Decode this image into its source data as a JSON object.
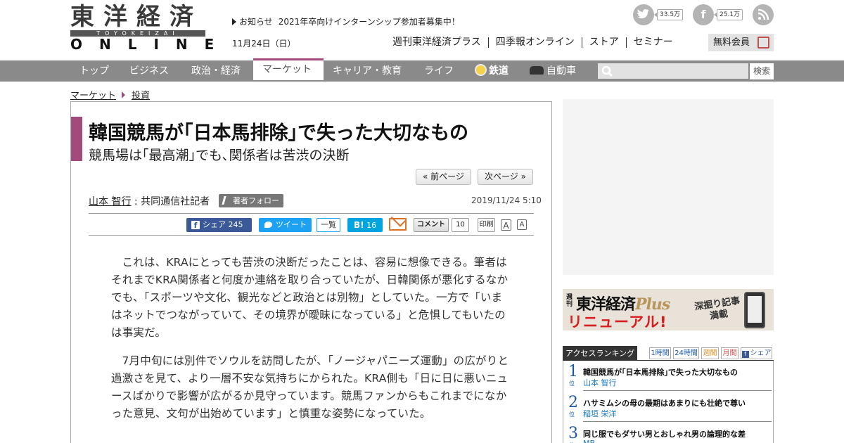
{
  "header": {
    "logo_kanji": "東洋経済",
    "logo_band": "TOYOKEIZAI",
    "logo_online": "ONLINE",
    "notice_label": "お知らせ",
    "notice_text": "2021年卒向けインターンシップ参加者募集中！",
    "date": "11月24日（日）",
    "social": {
      "twitter_count": "33.5万",
      "facebook_count": "25.1万"
    },
    "links": [
      "週刊東洋経済プラス",
      "四季報オンライン",
      "ストア",
      "セミナー"
    ],
    "member_button": "無料会員"
  },
  "nav": {
    "items": [
      "トップ",
      "ビジネス",
      "政治・経済",
      "マーケット",
      "キャリア・教育",
      "ライフ",
      "鉄道",
      "自動車"
    ],
    "active_index": 3,
    "search_placeholder": "",
    "search_button": "検索"
  },
  "breadcrumb": [
    "マーケット",
    "投資"
  ],
  "article": {
    "title": "韓国競馬が｢日本馬排除｣で失った大切なもの",
    "subtitle": "競馬場は｢最高潮｣でも､関係者は苦渋の決断",
    "prev_page": "« 前ページ",
    "next_page": "次ページ »",
    "author_name": "山本 智行",
    "author_affiliation": " : 共同通信社記者",
    "follow_label": "著者フォロー",
    "timestamp": "2019/11/24 5:10",
    "share": {
      "facebook_label": "シェア",
      "facebook_count": "245",
      "tweet_label": "ツイート",
      "list_label": "一覧",
      "hatena_label": "B!",
      "hatena_count": "16",
      "comment_label": "コメント",
      "comment_count": "10",
      "print_label": "印刷",
      "font_large": "A",
      "font_small": "A"
    },
    "paragraphs": [
      "これは、KRAにとっても苦渋の決断だったことは、容易に想像できる。筆者はそれまでKRA関係者と何度か連絡を取り合っていたが、日韓関係が悪化するなかでも、「スポーツや文化、観光などと政治とは別物」としていた。一方で「いまはネットでつながっていて、その境界が曖昧になっている」と危惧してもいたのは事実だ。",
      "7月中旬には別件でソウルを訪問したが、「ノージャパニーズ運動」の広がりと過激さを見て、より一層不安な気持ちにかられた。KRA側も「日に日に悪いニュースばかりで影響が広がるか見守っています。競馬ファンからもこれまでになかった意見、文句が出始めています」と慎重な姿勢になっていた。"
    ]
  },
  "sidebar": {
    "banner": {
      "weekly": "週刊",
      "name": "東洋経済",
      "plus": "Plus",
      "renewal": "リニューアル!",
      "feature": "深掘り記事満載"
    },
    "ranking": {
      "heading": "アクセスランキング",
      "tabs": [
        "1時間",
        "24時間",
        "週間",
        "月間",
        "シェア"
      ],
      "rank_suffix": "位",
      "items": [
        {
          "rank": "1",
          "title": "韓国競馬が｢日本馬排除｣で失った大切なもの",
          "author": "山本 智行"
        },
        {
          "rank": "2",
          "title": "ハサミムシの母の最期はあまりにも壮絶で尊い",
          "author": "稲垣 栄洋"
        },
        {
          "rank": "3",
          "title": "同じ服でもダサい男とおしゃれ男の論理的な差",
          "author": "MB"
        }
      ]
    }
  },
  "colors": {
    "accent": "#a3497c",
    "nav_bg": "#8a8a8a",
    "facebook": "#3b5998",
    "twitter": "#1da1f2",
    "hatena": "#00a4de",
    "rank_blue": "#1b59a7"
  }
}
